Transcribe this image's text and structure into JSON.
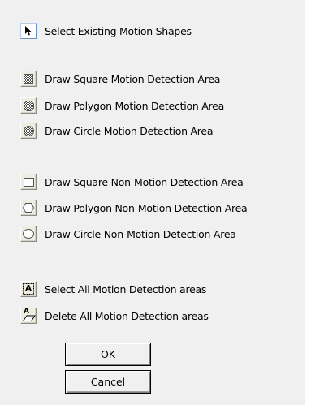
{
  "options": {
    "select_existing": {
      "label": "Select Existing Motion Shapes",
      "icon": "arrow-pointer-icon"
    },
    "motion": [
      {
        "label": "Draw Square Motion Detection Area",
        "icon": "hatched-square-icon"
      },
      {
        "label": "Draw Polygon Motion Detection Area",
        "icon": "hatched-polygon-icon"
      },
      {
        "label": "Draw Circle  Motion Detection Area",
        "icon": "hatched-circle-icon"
      }
    ],
    "non_motion": [
      {
        "label": "Draw Square Non-Motion Detection Area",
        "icon": "square-outline-icon"
      },
      {
        "label": "Draw Polygon Non-Motion Detection Area",
        "icon": "hexagon-outline-icon"
      },
      {
        "label": "Draw Circle  Non-Motion Detection Area",
        "icon": "circle-outline-icon"
      }
    ],
    "select_all": {
      "label": "Select All Motion Detection areas",
      "icon_text": "A",
      "icon": "select-all-icon"
    },
    "delete_all": {
      "label": "Delete  All Motion Detection areas",
      "icon_text": "A",
      "icon": "eraser-icon"
    }
  },
  "buttons": {
    "ok": "OK",
    "cancel": "Cancel"
  },
  "colors": {
    "background": "#f0f0f0",
    "button_face": "#efece2",
    "icon_fill": "#000000"
  }
}
